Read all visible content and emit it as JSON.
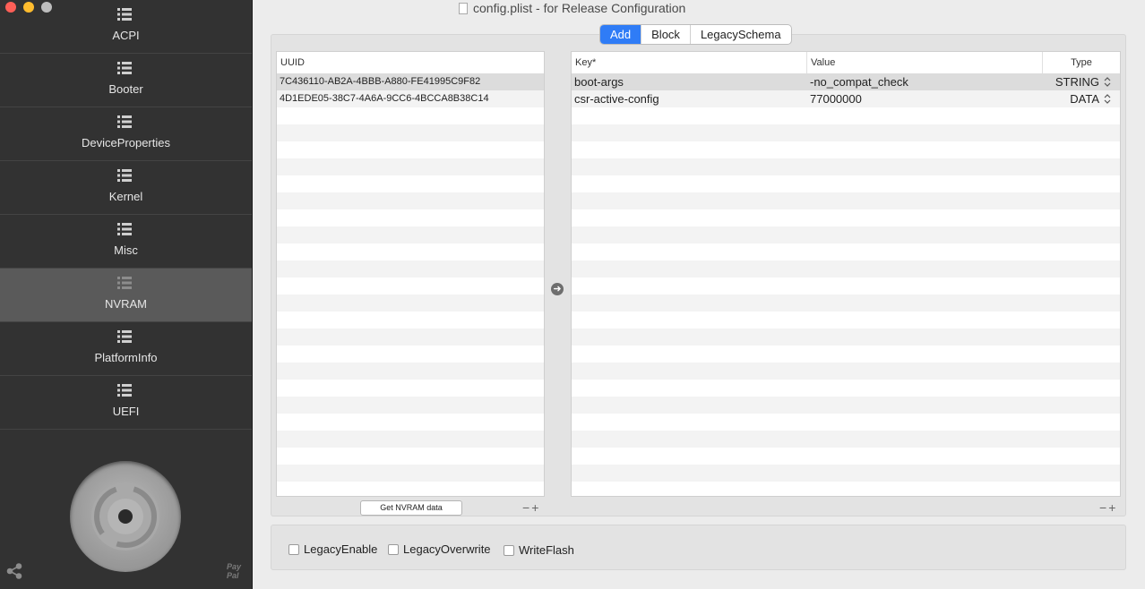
{
  "window": {
    "title": "config.plist - for Release Configuration"
  },
  "sidebar": {
    "items": [
      {
        "label": "ACPI"
      },
      {
        "label": "Booter"
      },
      {
        "label": "DeviceProperties"
      },
      {
        "label": "Kernel"
      },
      {
        "label": "Misc"
      },
      {
        "label": "NVRAM",
        "active": true
      },
      {
        "label": "PlatformInfo"
      },
      {
        "label": "UEFI"
      }
    ],
    "paypal_text": "Pay Pal"
  },
  "tabs": [
    {
      "label": "Add",
      "active": true
    },
    {
      "label": "Block"
    },
    {
      "label": "LegacySchema"
    }
  ],
  "uuid_table": {
    "header": "UUID",
    "rows": [
      "7C436110-AB2A-4BBB-A880-FE41995C9F82",
      "4D1EDE05-38C7-4A6A-9CC6-4BCCA8B38C14"
    ],
    "selected_index": 0
  },
  "kv_table": {
    "headers": {
      "key": "Key*",
      "value": "Value",
      "type": "Type"
    },
    "rows": [
      {
        "key": "boot-args",
        "value": "-no_compat_check",
        "type": "STRING"
      },
      {
        "key": "csr-active-config",
        "value": "77000000",
        "type": "DATA"
      }
    ],
    "selected_index": 0
  },
  "buttons": {
    "get_nvram": "Get NVRAM data",
    "minus": "−",
    "plus": "+"
  },
  "options": {
    "legacy_enable": "LegacyEnable",
    "legacy_overwrite": "LegacyOverwrite",
    "write_flash": "WriteFlash"
  },
  "colors": {
    "accent": "#2f7cf6",
    "sidebar_bg": "#323232",
    "sidebar_active": "#5a5a5a"
  }
}
